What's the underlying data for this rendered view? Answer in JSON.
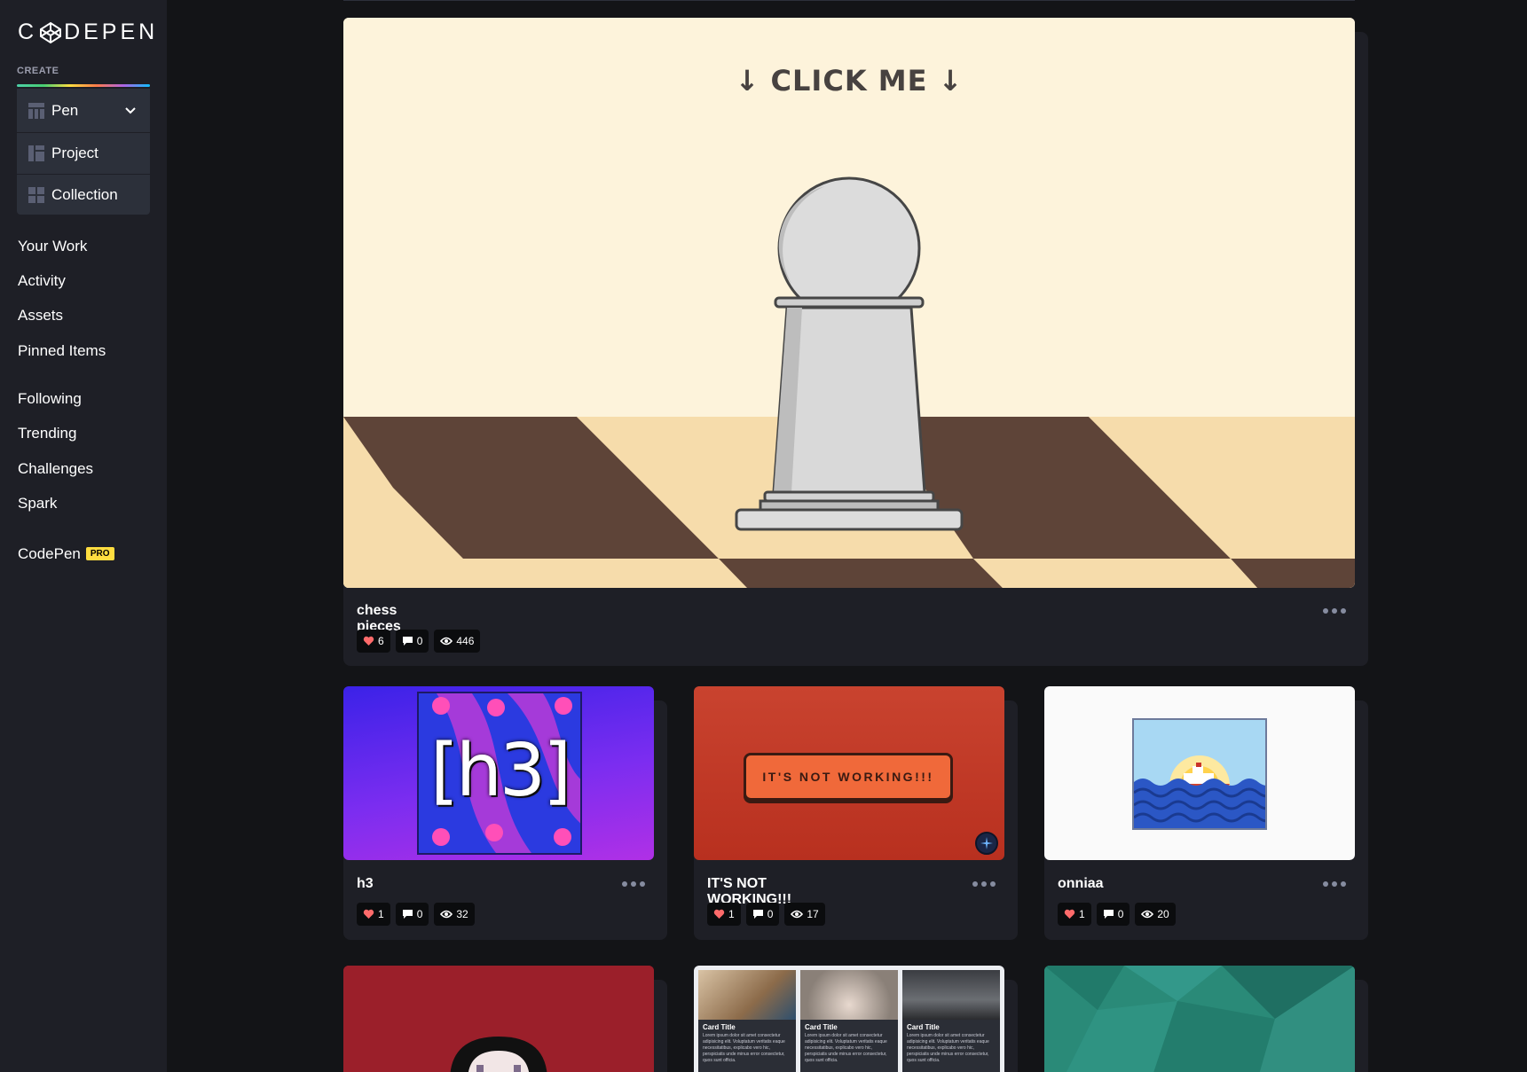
{
  "sidebar": {
    "logo": "C◈DEPEN",
    "create_label": "CREATE",
    "create_items": [
      {
        "label": "Pen"
      },
      {
        "label": "Project"
      },
      {
        "label": "Collection"
      }
    ],
    "nav_group_1": [
      "Your Work",
      "Activity",
      "Assets",
      "Pinned Items"
    ],
    "nav_group_2": [
      "Following",
      "Trending",
      "Challenges",
      "Spark"
    ],
    "pro_link": {
      "label": "CodePen",
      "badge": "PRO"
    }
  },
  "featured": {
    "preview_text": "↓ CLICK ME ↓",
    "title": "chess pieces",
    "likes": "6",
    "comments": "0",
    "views": "446"
  },
  "pens": [
    {
      "title": "h3",
      "likes": "1",
      "comments": "0",
      "views": "32",
      "preview_text": "[h3]"
    },
    {
      "title": "IT'S NOT WORKING!!!",
      "likes": "1",
      "comments": "0",
      "views": "17",
      "preview_text": "IT'S NOT WORKING!!!"
    },
    {
      "title": "onniaa",
      "likes": "1",
      "comments": "0",
      "views": "20"
    }
  ],
  "row3": {
    "mini_cards": [
      {
        "title": "Card Title",
        "text": "Lorem ipsum dolor sit amet consectetur adipisicing elit. Voluptatum veritatis eaque necessitatibus, explicabo vero hic, perspiciatis unde minus error consectetur, quos sunt officia."
      },
      {
        "title": "Card Title",
        "text": "Lorem ipsum dolor sit amet consectetur adipisicing elit. Voluptatum veritatis eaque necessitatibus, explicabo vero hic, perspiciatis unde minus error consectetur, quos sunt officia."
      },
      {
        "title": "Card Title",
        "text": "Lorem ipsum dolor sit amet consectetur adipisicing elit. Voluptatum veritatis eaque necessitatibus, explicabo vero hic, perspiciatis unde minus error consectetur, quos sunt officia."
      }
    ]
  },
  "colors": {
    "sidebar_bg": "#1e1f26",
    "page_bg": "#131417",
    "card_bg": "#1e1f26",
    "pro_badge": "#ffdd40",
    "heart": "#ff6b6b"
  },
  "icons": [
    "codepen-logo-icon",
    "pen-icon",
    "project-icon",
    "collection-icon",
    "chevron-down-icon",
    "heart-icon",
    "comment-icon",
    "eye-icon",
    "more-dots-icon"
  ]
}
